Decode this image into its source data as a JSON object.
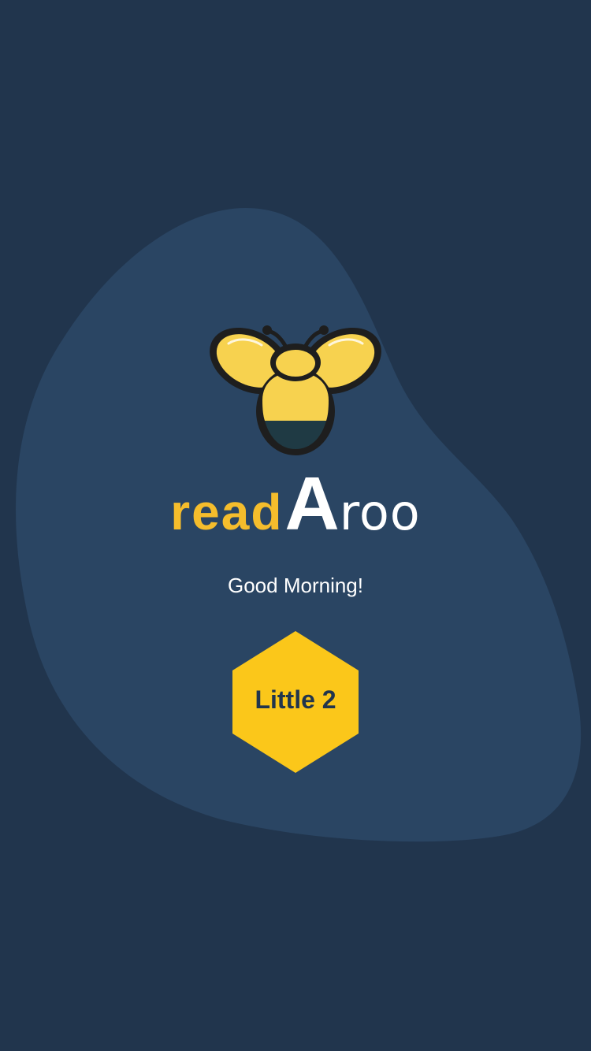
{
  "brand": {
    "part1": "read",
    "part2": "A",
    "part3": "roo",
    "logo_icon": "bee-icon"
  },
  "greeting": "Good Morning!",
  "level": {
    "label": "Little 2",
    "shape": "hexagon"
  },
  "colors": {
    "background": "#21354d",
    "blob": "#2a4563",
    "accent_yellow": "#f5bd2c",
    "badge_yellow": "#fbc71a",
    "text_white": "#ffffff"
  }
}
